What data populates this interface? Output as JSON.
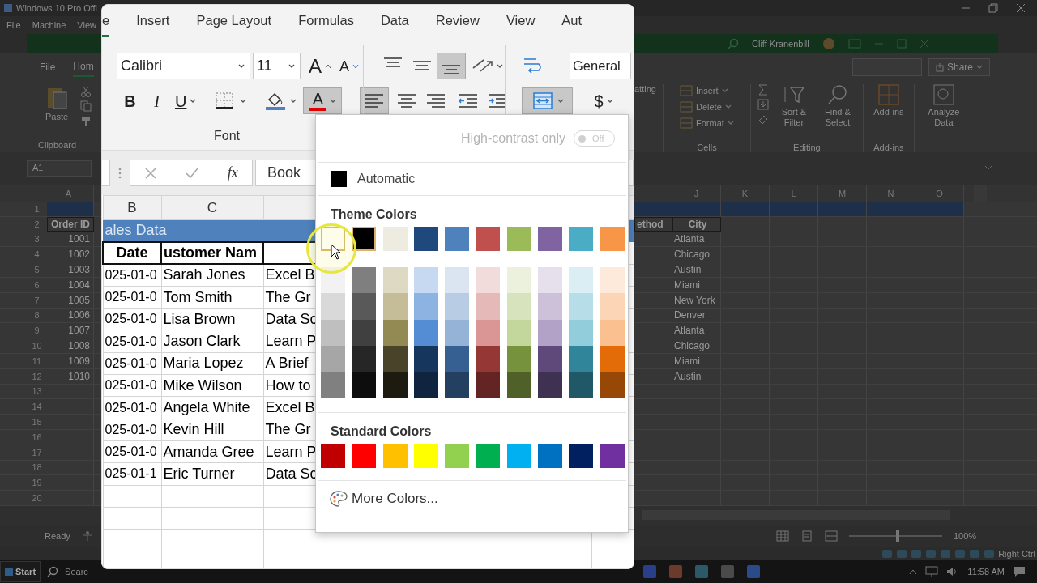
{
  "host_window": {
    "title": "Windows 10 Pro Offi",
    "menu": [
      "File",
      "Machine",
      "View"
    ]
  },
  "excel": {
    "account": "Cliff Kranenbill",
    "tabs": [
      {
        "label": "File",
        "selected": false
      },
      {
        "label": "Hom",
        "selected": true
      }
    ],
    "share": "Share",
    "clipboard": {
      "paste": "Paste",
      "group": "Clipboard"
    },
    "styles_cut": "atting",
    "cells": {
      "items": [
        "Insert",
        "Delete",
        "Format"
      ],
      "group": "Cells"
    },
    "editing": {
      "sort": "Sort & Filter",
      "find": "Find & Select",
      "group": "Editing"
    },
    "addins": {
      "button": "Add-ins",
      "group": "Add-ins"
    },
    "analyze": "Analyze Data",
    "name_box": "A1",
    "columns_left": [
      "A"
    ],
    "columns_right": [
      "J",
      "K",
      "L",
      "M",
      "N",
      "O"
    ],
    "rows": [
      {
        "number": "1",
        "kind": "title"
      },
      {
        "number": "2",
        "kind": "header",
        "a": "Order ID",
        "i": "ethod",
        "j": "City"
      },
      {
        "number": "3",
        "kind": "data",
        "a": "1001",
        "j": "Atlanta"
      },
      {
        "number": "4",
        "kind": "data",
        "a": "1002",
        "j": "Chicago"
      },
      {
        "number": "5",
        "kind": "data",
        "a": "1003",
        "j": "Austin"
      },
      {
        "number": "6",
        "kind": "data",
        "a": "1004",
        "j": "Miami"
      },
      {
        "number": "7",
        "kind": "data",
        "a": "1005",
        "j": "New York"
      },
      {
        "number": "8",
        "kind": "data",
        "a": "1006",
        "j": "Denver"
      },
      {
        "number": "9",
        "kind": "data",
        "a": "1007",
        "j": "Atlanta"
      },
      {
        "number": "10",
        "kind": "data",
        "a": "1008",
        "j": "Chicago"
      },
      {
        "number": "11",
        "kind": "data",
        "a": "1009",
        "j": "Miami"
      },
      {
        "number": "12",
        "kind": "data",
        "a": "1010",
        "j": "Austin"
      },
      {
        "number": "13",
        "kind": "empty"
      },
      {
        "number": "14",
        "kind": "empty"
      },
      {
        "number": "15",
        "kind": "empty"
      },
      {
        "number": "16",
        "kind": "empty"
      },
      {
        "number": "17",
        "kind": "empty"
      },
      {
        "number": "18",
        "kind": "empty"
      },
      {
        "number": "19",
        "kind": "empty"
      },
      {
        "number": "20",
        "kind": "empty"
      }
    ],
    "status": "Ready",
    "zoom": {
      "label": "100%",
      "level": 0.5
    }
  },
  "vm_status": {
    "host_key": "Right Ctrl"
  },
  "taskbar": {
    "start": "Start",
    "search": "Searc",
    "time": "11:58 AM"
  },
  "magnifier": {
    "tabs": [
      {
        "label": "e",
        "selected": true
      },
      {
        "label": "Insert",
        "selected": false
      },
      {
        "label": "Page Layout",
        "selected": false
      },
      {
        "label": "Formulas",
        "selected": false
      },
      {
        "label": "Data",
        "selected": false
      },
      {
        "label": "Review",
        "selected": false
      },
      {
        "label": "View",
        "selected": false
      },
      {
        "label": "Aut",
        "selected": false
      }
    ],
    "row1": [
      {
        "kind": "fontname",
        "value": "Calibri"
      },
      {
        "kind": "fontsize",
        "value": "11"
      },
      {
        "kind": "grow",
        "label": "A",
        "selected": false
      },
      {
        "kind": "shrink",
        "label": "A",
        "selected": false
      },
      {
        "kind": "top",
        "selected": false
      },
      {
        "kind": "middle",
        "selected": false
      },
      {
        "kind": "bottom",
        "selected": true
      },
      {
        "kind": "orientation",
        "selected": false
      },
      {
        "kind": "wrap",
        "selected": false
      },
      {
        "kind": "numberformat",
        "value": "General"
      }
    ],
    "row2": [
      {
        "kind": "bold",
        "label": "B",
        "selected": false
      },
      {
        "kind": "italic",
        "label": "I",
        "selected": false
      },
      {
        "kind": "underline",
        "label": "U",
        "selected": false
      },
      {
        "kind": "borders",
        "selected": false
      },
      {
        "kind": "fill",
        "selected": false
      },
      {
        "kind": "fontcolor",
        "label": "A",
        "selected": true
      },
      {
        "kind": "left",
        "selected": true
      },
      {
        "kind": "center",
        "selected": false
      },
      {
        "kind": "right",
        "selected": false
      },
      {
        "kind": "outdent",
        "selected": false
      },
      {
        "kind": "indent",
        "selected": false
      },
      {
        "kind": "merge",
        "selected": true
      },
      {
        "kind": "currency",
        "label": "$",
        "selected": false
      }
    ],
    "font_group": "Font",
    "formula": {
      "fx": "fx",
      "value": "Book"
    },
    "columns": [
      "B",
      "C"
    ],
    "title": "ales Data",
    "headers": [
      "Date",
      "ustomer Nam"
    ],
    "rows": [
      [
        "025-01-0",
        "Sarah Jones",
        "Excel B"
      ],
      [
        "025-01-0",
        "Tom Smith",
        "The Gr"
      ],
      [
        "025-01-0",
        "Lisa Brown",
        "Data Sc"
      ],
      [
        "025-01-0",
        "Jason Clark",
        "Learn P"
      ],
      [
        "025-01-0",
        "Maria Lopez",
        "A Brief"
      ],
      [
        "025-01-0",
        "Mike Wilson",
        "How to"
      ],
      [
        "025-01-0",
        "Angela White",
        "Excel B"
      ],
      [
        "025-01-0",
        "Kevin Hill",
        "The Gr"
      ],
      [
        "025-01-0",
        "Amanda Gree",
        "Learn P"
      ],
      [
        "025-01-1",
        "Eric Turner",
        "Data Sc"
      ]
    ],
    "popup": {
      "high_contrast": {
        "label": "High-contrast only",
        "on": false,
        "state": "Off"
      },
      "automatic": {
        "label": "Automatic",
        "color": "#000000"
      },
      "theme_title": "Theme Colors",
      "theme": [
        {
          "color": "#ffffff",
          "selected": true,
          "shades": [
            {
              "color": "#f2f2f2"
            },
            {
              "color": "#d9d9d9"
            },
            {
              "color": "#bfbfbf"
            },
            {
              "color": "#a6a6a6"
            },
            {
              "color": "#808080"
            }
          ]
        },
        {
          "color": "#000000",
          "selected": true,
          "shades": [
            {
              "color": "#7f7f7f"
            },
            {
              "color": "#595959"
            },
            {
              "color": "#404040"
            },
            {
              "color": "#262626"
            },
            {
              "color": "#0d0d0d"
            }
          ]
        },
        {
          "color": "#eeece1",
          "selected": false,
          "shades": [
            {
              "color": "#ddd9c3"
            },
            {
              "color": "#c4bd97"
            },
            {
              "color": "#938953"
            },
            {
              "color": "#494429"
            },
            {
              "color": "#1d1b10"
            }
          ]
        },
        {
          "color": "#1f497d",
          "selected": false,
          "shades": [
            {
              "color": "#c6d9f0"
            },
            {
              "color": "#8db3e2"
            },
            {
              "color": "#548dd4"
            },
            {
              "color": "#17365d"
            },
            {
              "color": "#0f243e"
            }
          ]
        },
        {
          "color": "#4f81bd",
          "selected": false,
          "shades": [
            {
              "color": "#dbe5f1"
            },
            {
              "color": "#b8cce4"
            },
            {
              "color": "#95b3d7"
            },
            {
              "color": "#366092"
            },
            {
              "color": "#244061"
            }
          ]
        },
        {
          "color": "#c0504d",
          "selected": false,
          "shades": [
            {
              "color": "#f2dcdb"
            },
            {
              "color": "#e5b9b7"
            },
            {
              "color": "#d99694"
            },
            {
              "color": "#953734"
            },
            {
              "color": "#632423"
            }
          ]
        },
        {
          "color": "#9bbb59",
          "selected": false,
          "shades": [
            {
              "color": "#ebf1dd"
            },
            {
              "color": "#d7e3bc"
            },
            {
              "color": "#c3d69b"
            },
            {
              "color": "#76923c"
            },
            {
              "color": "#4f6128"
            }
          ]
        },
        {
          "color": "#8064a2",
          "selected": false,
          "shades": [
            {
              "color": "#e5e0ec"
            },
            {
              "color": "#ccc1d9"
            },
            {
              "color": "#b2a2c7"
            },
            {
              "color": "#5f497a"
            },
            {
              "color": "#3f3151"
            }
          ]
        },
        {
          "color": "#4bacc6",
          "selected": false,
          "shades": [
            {
              "color": "#dbeef3"
            },
            {
              "color": "#b7dde8"
            },
            {
              "color": "#92cddc"
            },
            {
              "color": "#31859b"
            },
            {
              "color": "#205867"
            }
          ]
        },
        {
          "color": "#f79646",
          "selected": false,
          "shades": [
            {
              "color": "#fdeada"
            },
            {
              "color": "#fbd5b5"
            },
            {
              "color": "#fac08f"
            },
            {
              "color": "#e36c09"
            },
            {
              "color": "#974806"
            }
          ]
        }
      ],
      "standard_title": "Standard Colors",
      "standard": [
        {
          "color": "#c00000"
        },
        {
          "color": "#ff0000"
        },
        {
          "color": "#ffc000"
        },
        {
          "color": "#ffff00"
        },
        {
          "color": "#92d050"
        },
        {
          "color": "#00b050"
        },
        {
          "color": "#00b0f0"
        },
        {
          "color": "#0070c0"
        },
        {
          "color": "#002060"
        },
        {
          "color": "#7030a0"
        }
      ],
      "more": "More Colors..."
    }
  }
}
